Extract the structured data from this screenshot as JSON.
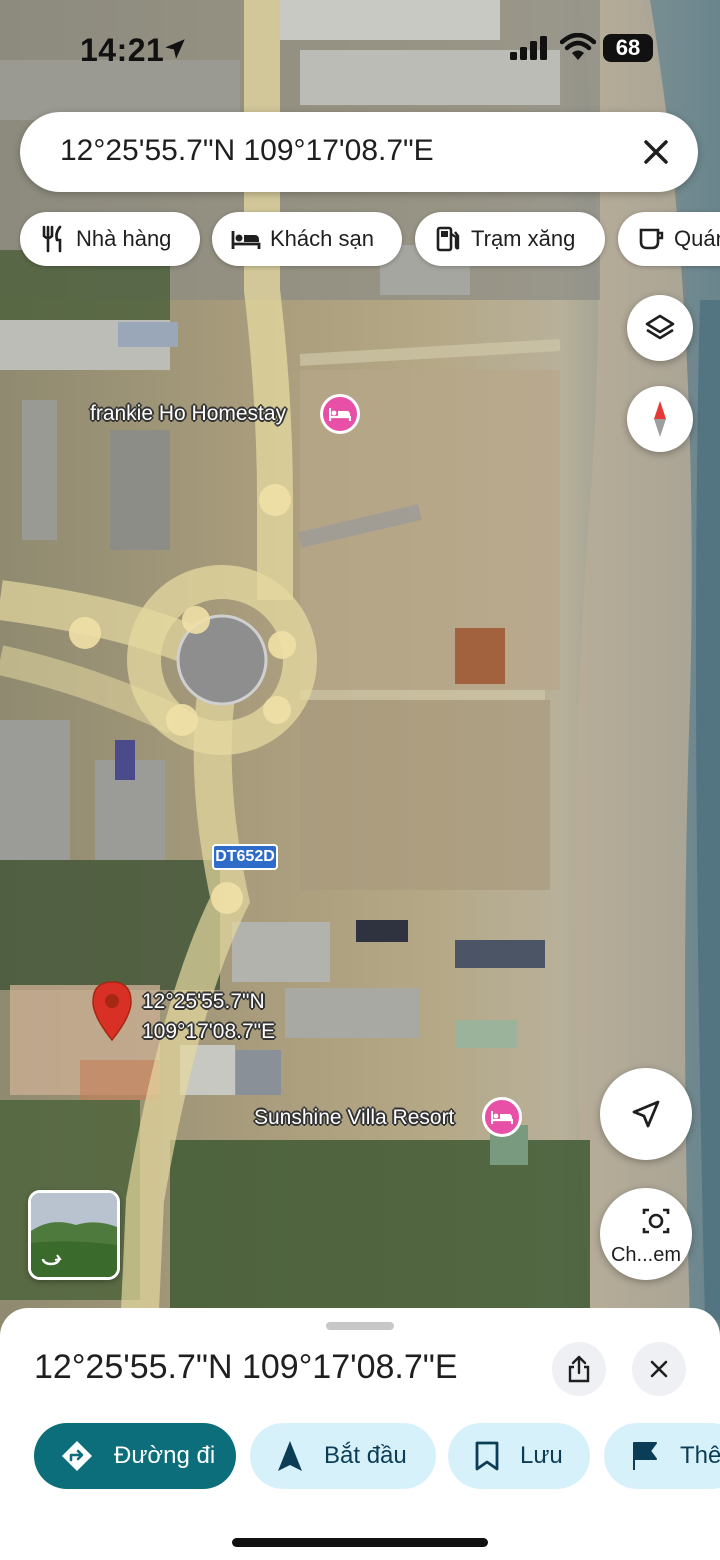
{
  "status_bar": {
    "time": "14:21",
    "battery": "68"
  },
  "search": {
    "query": "12°25'55.7\"N 109°17'08.7\"E"
  },
  "chips": [
    {
      "label": "Nhà hàng",
      "icon": "restaurant-icon"
    },
    {
      "label": "Khách sạn",
      "icon": "hotel-icon"
    },
    {
      "label": "Trạm xăng",
      "icon": "gas-station-icon"
    },
    {
      "label": "Quán",
      "icon": "coffee-icon"
    }
  ],
  "map": {
    "places": [
      {
        "name": "frankie Ho Homestay",
        "icon": "hotel-icon",
        "color": "#e84fa7"
      },
      {
        "name": "Sunshine Villa Resort",
        "icon": "hotel-icon",
        "color": "#e84fa7"
      }
    ],
    "road_label": "DT652D",
    "pin": {
      "lat": "12°25'55.7\"N",
      "lng": "109°17'08.7\"E",
      "color": "#d93025"
    }
  },
  "controls": {
    "layers_icon": "layers-icon",
    "compass_icon": "compass-icon",
    "my_location_icon": "navigation-arrow-icon",
    "camera_label": "Ch...em"
  },
  "sheet": {
    "title": "12°25'55.7\"N 109°17'08.7\"E",
    "actions": [
      {
        "label": "Đường đi",
        "icon": "directions-icon"
      },
      {
        "label": "Bắt đầu",
        "icon": "start-navigation-icon"
      },
      {
        "label": "Lưu",
        "icon": "bookmark-icon"
      },
      {
        "label": "Thê",
        "icon": "flag-icon"
      }
    ]
  },
  "colors": {
    "accent": "#0c6e7a",
    "action_bg": "#d7f1fa",
    "poi": "#e84fa7",
    "pin": "#d93025",
    "road": "#e6d9a0"
  }
}
